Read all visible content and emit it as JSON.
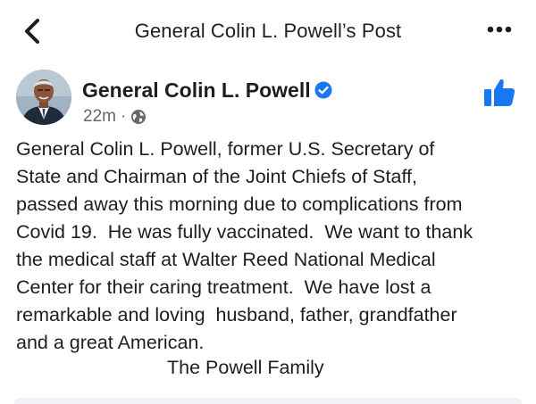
{
  "nav": {
    "title": "General Colin L. Powell’s Post",
    "back_icon": "chevron-left-icon",
    "more_icon": "more-horizontal-icon"
  },
  "post": {
    "author": "General Colin L. Powell",
    "verified_icon": "verified-badge-icon",
    "time": "22m",
    "separator": "·",
    "audience_icon": "globe-icon",
    "like_icon": "thumbs-up-icon",
    "lines": [
      "General Colin L. Powell, former U.S. Secretary of",
      "State and Chairman of the Joint Chiefs of Staff,",
      "passed away this morning due to complications from",
      "Covid 19.  He was fully vaccinated.  We want to thank",
      "the medical staff at Walter Reed National Medical",
      "Center for their caring treatment.  We have lost a",
      "remarkable and loving  husband, father, grandfather",
      "and a great American."
    ],
    "signature": "The Powell Family"
  },
  "colors": {
    "accent": "#1877f2",
    "text": "#1c1e21",
    "secondary": "#65676b"
  }
}
